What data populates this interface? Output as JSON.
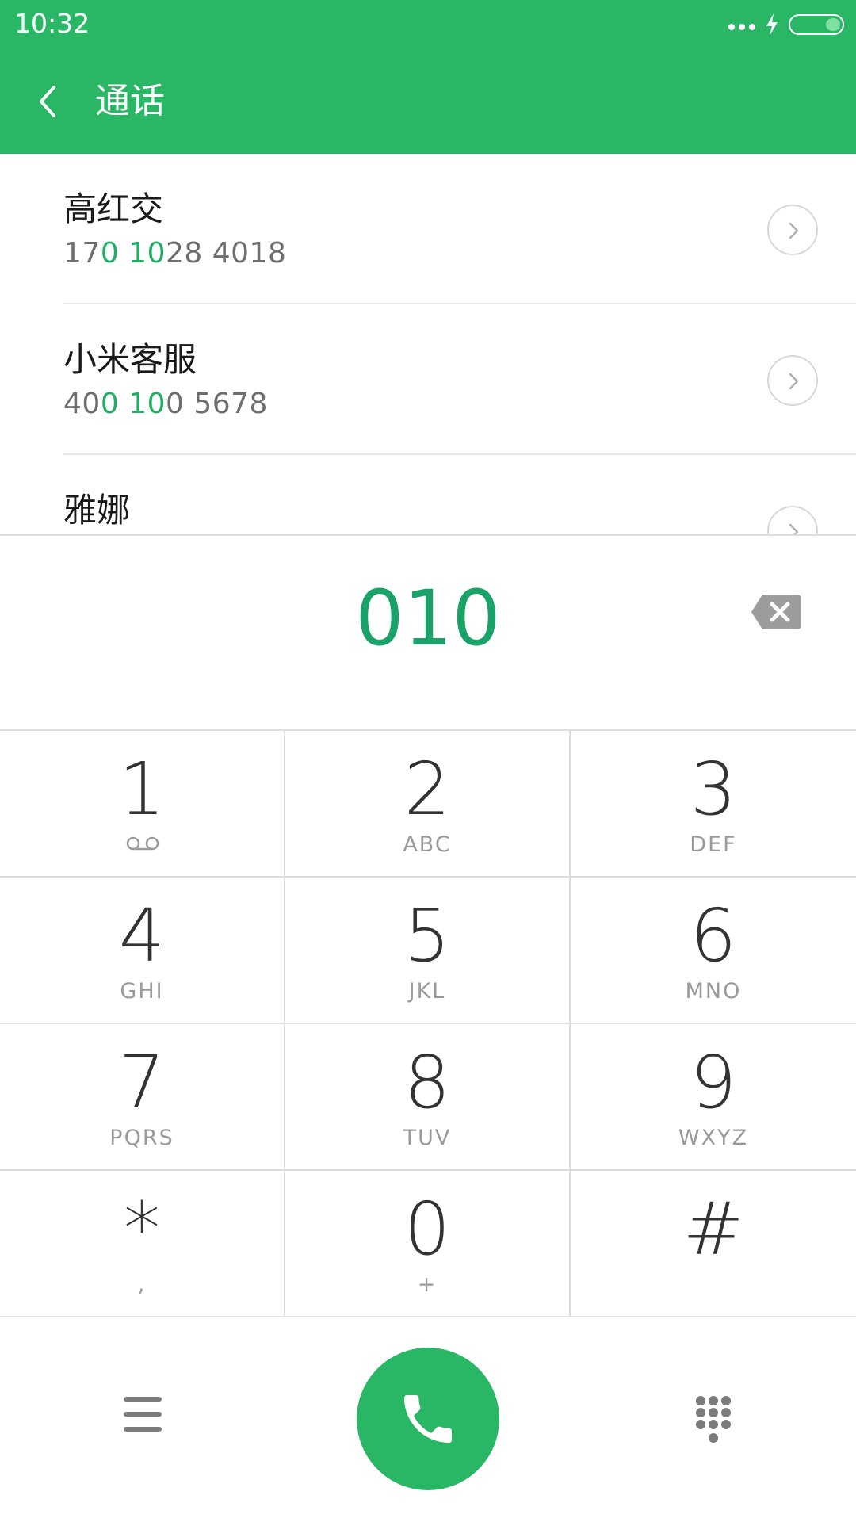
{
  "status": {
    "time": "10:32"
  },
  "header": {
    "title": "通话"
  },
  "contacts": [
    {
      "name": "高红交",
      "number_parts": [
        [
          "17",
          "plain"
        ],
        [
          "0",
          "hl"
        ],
        [
          " ",
          "plain"
        ],
        [
          "10",
          "hl"
        ],
        [
          "28 4018",
          "plain"
        ]
      ]
    },
    {
      "name": "小米客服",
      "number_parts": [
        [
          "40",
          "plain"
        ],
        [
          "0",
          "hl"
        ],
        [
          " ",
          "plain"
        ],
        [
          "10",
          "hl"
        ],
        [
          "0 5678",
          "plain"
        ]
      ]
    },
    {
      "name": "雅娜",
      "number_parts": []
    }
  ],
  "dialed_number": "010",
  "keypad": [
    {
      "digit": "1",
      "letters": ""
    },
    {
      "digit": "2",
      "letters": "ABC"
    },
    {
      "digit": "3",
      "letters": "DEF"
    },
    {
      "digit": "4",
      "letters": "GHI"
    },
    {
      "digit": "5",
      "letters": "JKL"
    },
    {
      "digit": "6",
      "letters": "MNO"
    },
    {
      "digit": "7",
      "letters": "PQRS"
    },
    {
      "digit": "8",
      "letters": "TUV"
    },
    {
      "digit": "9",
      "letters": "WXYZ"
    },
    {
      "digit": "*",
      "letters": ","
    },
    {
      "digit": "0",
      "letters": "+"
    },
    {
      "digit": "#",
      "letters": ""
    }
  ],
  "icons": {
    "back": "chevron-left-icon",
    "detail": "chevron-right-icon",
    "backspace": "backspace-icon",
    "voicemail": "voicemail-icon",
    "menu": "menu-icon",
    "call": "phone-icon",
    "dialpad": "dialpad-icon"
  },
  "colors": {
    "brand": "#29b765",
    "highlight": "#1fae64",
    "dialed": "#1aa368"
  }
}
